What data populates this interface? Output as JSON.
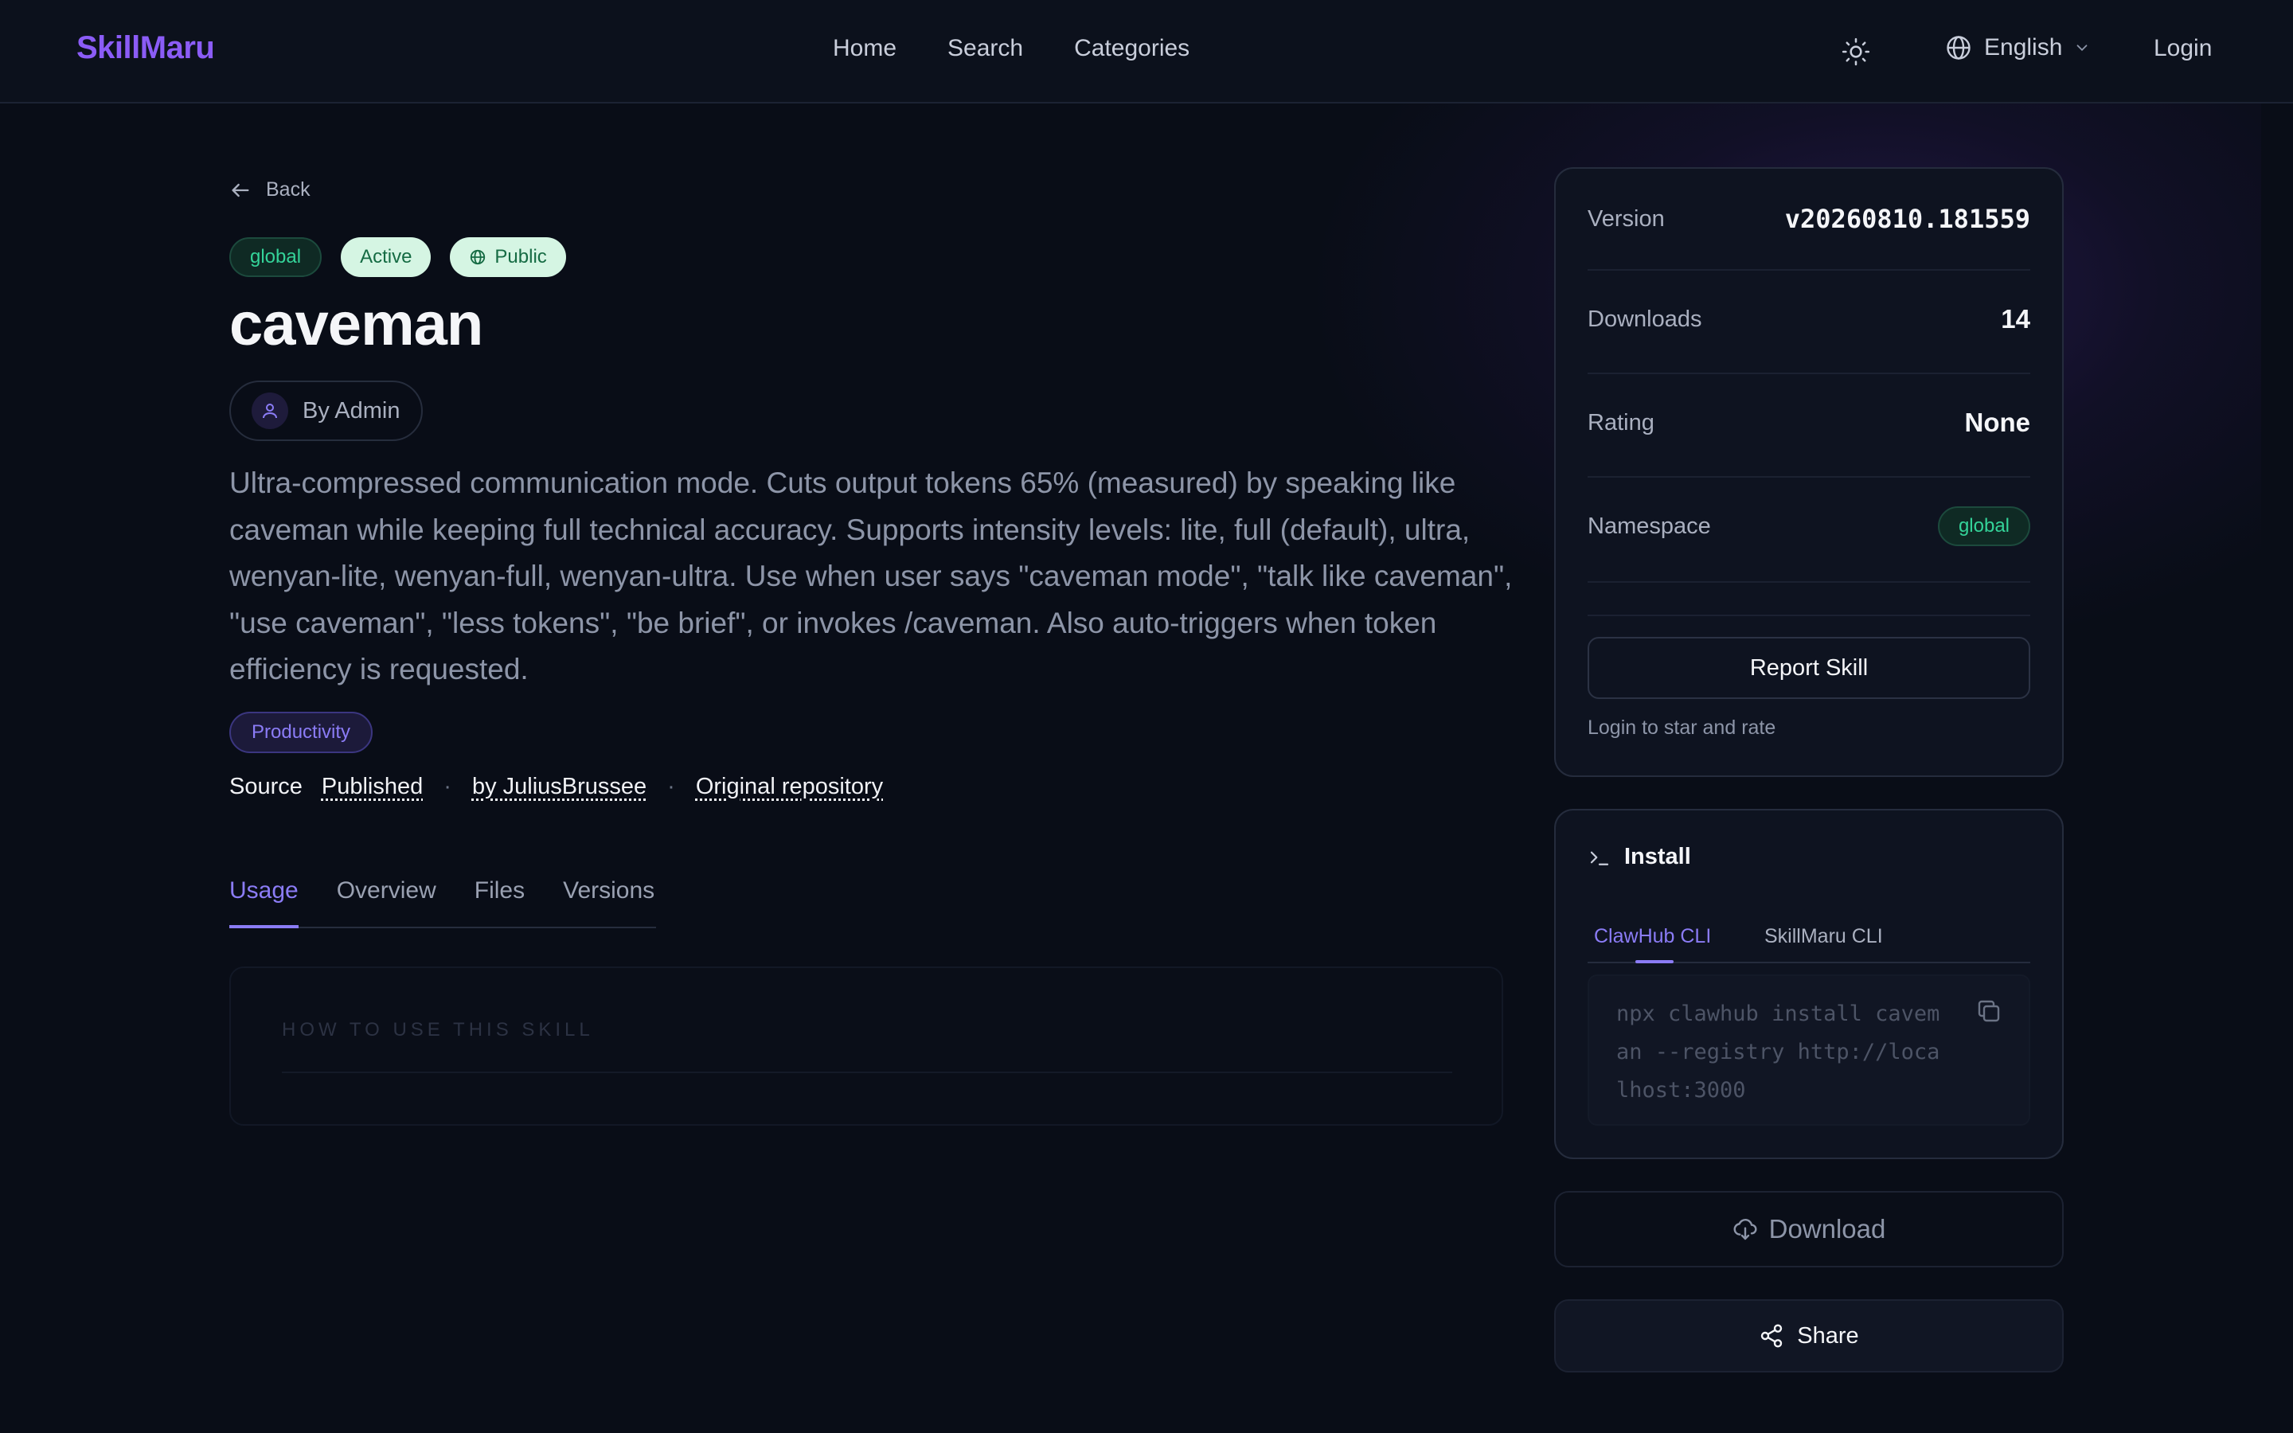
{
  "header": {
    "logo": "SkillMaru",
    "nav": [
      "Home",
      "Search",
      "Categories"
    ],
    "theme_icon": "sun-icon",
    "language": "English",
    "login": "Login"
  },
  "skill": {
    "back": "Back",
    "badges": {
      "namespace": "global",
      "status": "Active",
      "visibility": "Public"
    },
    "name": "caveman",
    "author": "By Admin",
    "description": "Ultra-compressed communication mode. Cuts output tokens 65% (measured) by speaking like caveman while keeping full technical accuracy. Supports intensity levels: lite, full (default), ultra, wenyan-lite, wenyan-full, wenyan-ultra. Use when user says \"caveman mode\", \"talk like caveman\", \"use caveman\", \"less tokens\", \"be brief\", or invokes /caveman. Also auto-triggers when token efficiency is requested.",
    "category": "Productivity",
    "source": {
      "label": "Source",
      "published": "Published",
      "by": "by JuliusBrussee",
      "repo": "Original repository"
    },
    "tabs": [
      "Usage",
      "Overview",
      "Files",
      "Versions"
    ],
    "active_tab": "Usage",
    "usage_heading": "HOW TO USE THIS SKILL"
  },
  "info": {
    "version_label": "Version",
    "version": "v20260810.181559",
    "downloads_label": "Downloads",
    "downloads": "14",
    "rating_label": "Rating",
    "rating": "None",
    "namespace_label": "Namespace",
    "namespace": "global",
    "report": "Report Skill",
    "login_note": "Login to star and rate"
  },
  "install": {
    "title": "Install",
    "tabs": [
      "ClawHub CLI",
      "SkillMaru CLI"
    ],
    "active_tab": "ClawHub CLI",
    "command": "npx clawhub install caveman --registry http://localhost:3000"
  },
  "actions": {
    "download": "Download",
    "share": "Share"
  },
  "colors": {
    "accent": "#8b5cf6",
    "success": "#34d399",
    "background": "#090d17"
  }
}
